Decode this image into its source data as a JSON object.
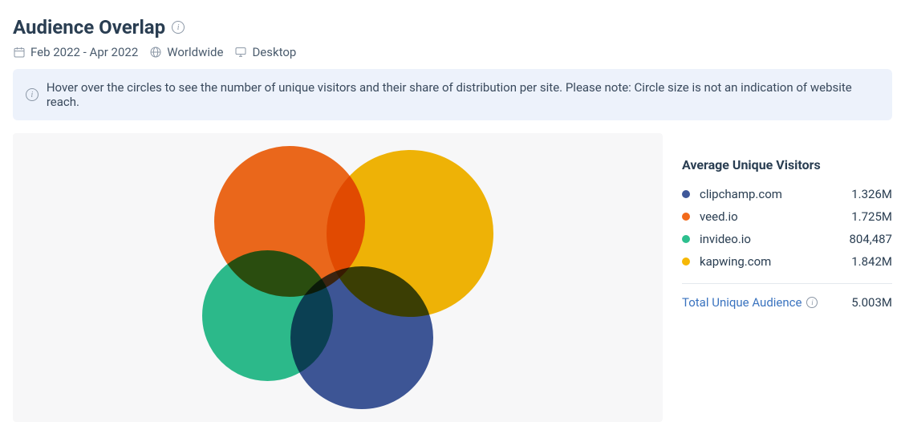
{
  "header": {
    "title": "Audience Overlap",
    "date_range": "Feb 2022 - Apr 2022",
    "region": "Worldwide",
    "device": "Desktop"
  },
  "notice": "Hover over the circles to see the number of unique visitors and their share of distribution per site. Please note: Circle size is not an indication of website reach.",
  "side": {
    "title": "Average Unique Visitors",
    "items": [
      {
        "label": "clipchamp.com",
        "value": "1.326M",
        "color": "#3f5899"
      },
      {
        "label": "veed.io",
        "value": "1.725M",
        "color": "#f26a1b"
      },
      {
        "label": "invideo.io",
        "value": "804,487",
        "color": "#2dbf8e"
      },
      {
        "label": "kapwing.com",
        "value": "1.842M",
        "color": "#f6b806"
      }
    ],
    "total_label": "Total Unique Audience",
    "total_value": "5.003M"
  },
  "chart_data": {
    "type": "venn",
    "title": "Audience Overlap",
    "series": [
      {
        "name": "clipchamp.com",
        "value": 1326000,
        "display": "1.326M",
        "color": "#3f5899"
      },
      {
        "name": "veed.io",
        "value": 1725000,
        "display": "1.725M",
        "color": "#f26a1b"
      },
      {
        "name": "invideo.io",
        "value": 804487,
        "display": "804,487",
        "color": "#2dbf8e"
      },
      {
        "name": "kapwing.com",
        "value": 1842000,
        "display": "1.842M",
        "color": "#f6b806"
      }
    ],
    "total_unique_audience": 5003000,
    "note": "Circle size is not an indication of website reach."
  }
}
